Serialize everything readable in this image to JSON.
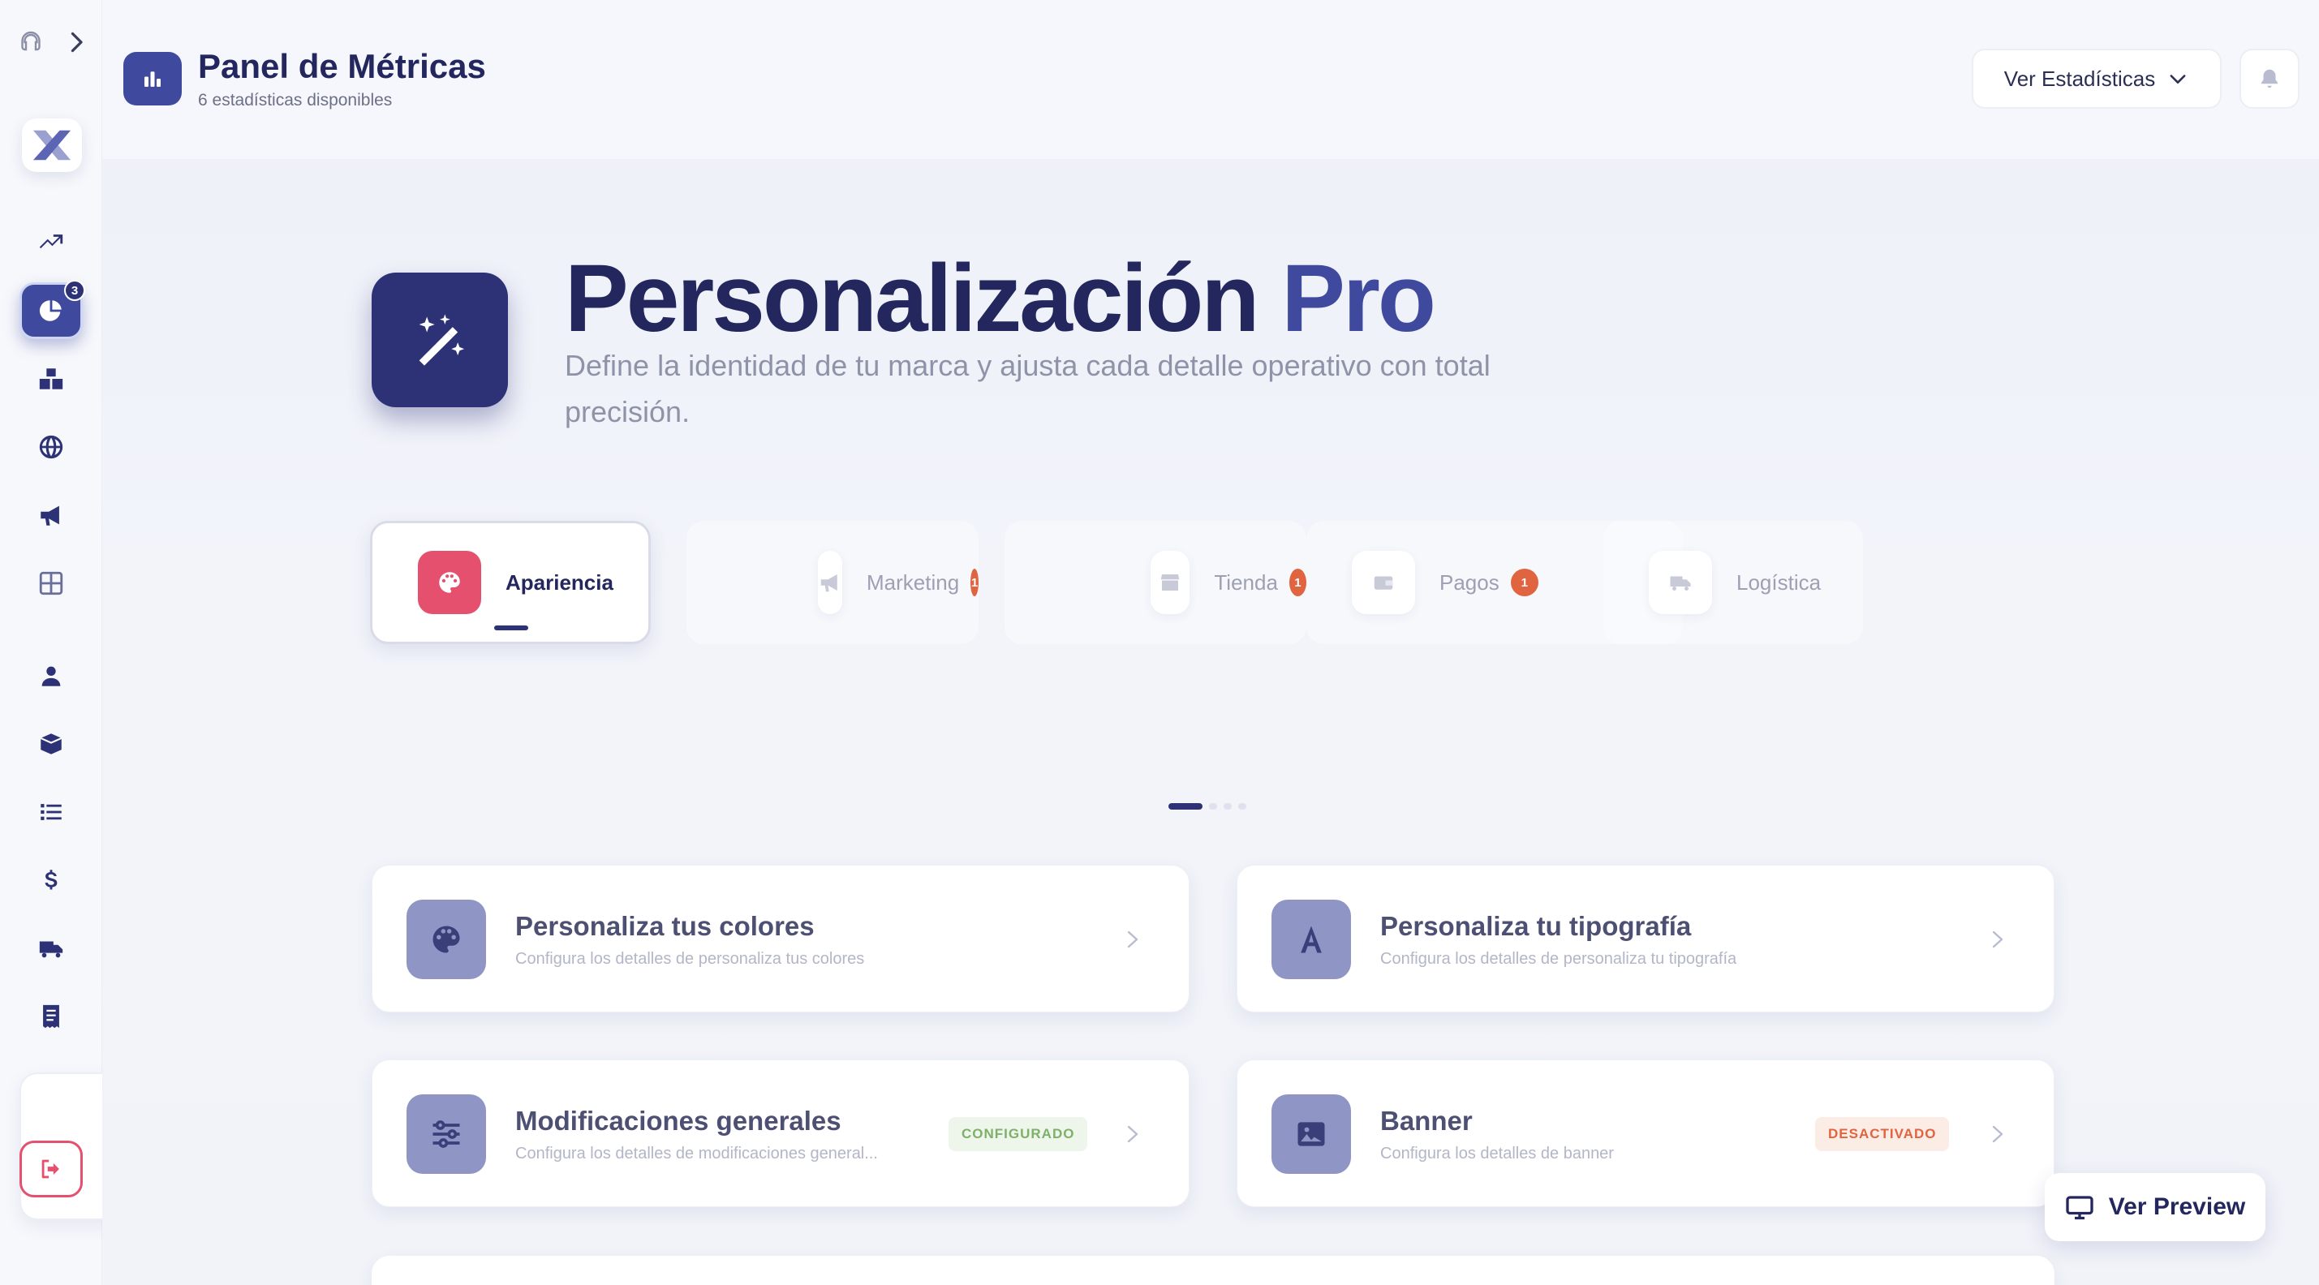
{
  "header": {
    "title": "Panel de Métricas",
    "subtitle": "6 estadísticas disponibles",
    "stats_button": "Ver Estadísticas"
  },
  "sidebar": {
    "active_badge": "3",
    "items": [
      {
        "icon": "trending-up-icon"
      },
      {
        "icon": "pie-chart-icon",
        "active": true
      },
      {
        "icon": "boxes-icon"
      },
      {
        "icon": "globe-icon"
      },
      {
        "icon": "megaphone-icon"
      },
      {
        "icon": "grid-icon"
      },
      {
        "icon": "user-icon"
      },
      {
        "icon": "box-icon"
      },
      {
        "icon": "list-icon"
      },
      {
        "icon": "dollar-icon"
      },
      {
        "icon": "truck-icon"
      },
      {
        "icon": "receipt-icon"
      },
      {
        "icon": "credit-card-icon"
      },
      {
        "icon": "logout-icon"
      }
    ]
  },
  "hero": {
    "title_main": "Personalización",
    "title_accent": "Pro",
    "description": "Define la identidad de tu marca y ajusta cada detalle operativo con total precisión."
  },
  "tabs": [
    {
      "label": "Apariencia",
      "badge": "",
      "active": true
    },
    {
      "label": "Marketing",
      "badge": "1"
    },
    {
      "label": "Tienda",
      "badge": "1"
    },
    {
      "label": "Pagos",
      "badge": "1"
    },
    {
      "label": "Logística",
      "badge": ""
    }
  ],
  "cards": [
    {
      "title": "Personaliza tus colores",
      "description": "Configura los detalles de personaliza tus colores",
      "badge": ""
    },
    {
      "title": "Personaliza tu tipografía",
      "description": "Configura los detalles de personaliza tu tipografía",
      "badge": ""
    },
    {
      "title": "Modificaciones generales",
      "description": "Configura los detalles de modificaciones general...",
      "badge": "CONFIGURADO"
    },
    {
      "title": "Banner",
      "description": "Configura los detalles de banner",
      "badge": "DESACTIVADO"
    }
  ],
  "preview_button": "Ver Preview",
  "colors": {
    "primary": "#2d3277",
    "accent": "#3f4a9e",
    "pink": "#e5506e",
    "orange_badge": "#e0643f",
    "card_icon": "#8f95c4"
  }
}
